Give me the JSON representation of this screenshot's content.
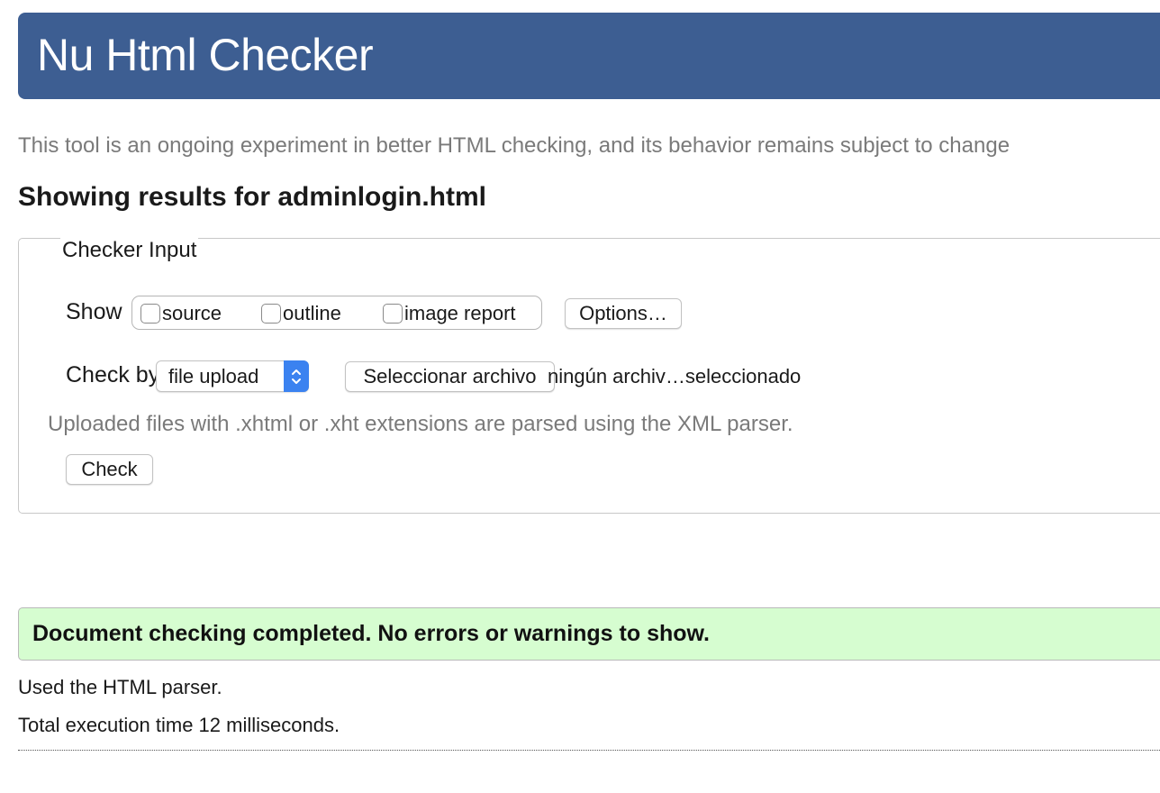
{
  "header": {
    "title": "Nu Html Checker"
  },
  "tagline": "This tool is an ongoing experiment in better HTML checking, and its behavior remains subject to change",
  "results_title": "Showing results for adminlogin.html",
  "checker_input": {
    "legend": "Checker Input",
    "show_label": "Show",
    "show_options": [
      {
        "label": "source",
        "checked": false
      },
      {
        "label": "outline",
        "checked": false
      },
      {
        "label": "image report",
        "checked": false
      }
    ],
    "options_button": "Options…",
    "check_by_label": "Check by",
    "check_by_selected": "file upload",
    "choose_file_button": "Seleccionar archivo",
    "file_status": "ningún archiv…seleccionado",
    "hint": "Uploaded files with .xhtml or .xht extensions are parsed using the XML parser.",
    "check_button": "Check"
  },
  "result": {
    "message": "Document checking completed. No errors or warnings to show.",
    "parser_info": "Used the HTML parser.",
    "execution_time": "Total execution time 12 milliseconds."
  },
  "colors": {
    "header_bg": "#3d5e92",
    "success_bg": "#d6fdd0",
    "select_accent": "#3b82f0",
    "muted_text": "#7a7a7a"
  },
  "icons": {
    "select_arrows": "updown-chevron-icon"
  }
}
